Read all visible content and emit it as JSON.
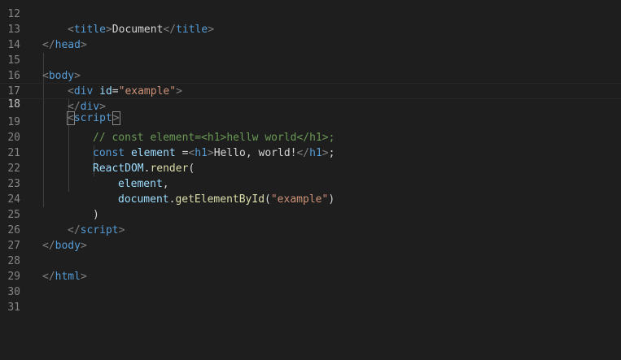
{
  "editor": {
    "line_numbers": [
      "12",
      "13",
      "14",
      "15",
      "16",
      "17",
      "18",
      "19",
      "20",
      "21",
      "22",
      "23",
      "24",
      "25",
      "26",
      "27",
      "28",
      "29",
      "30",
      "31"
    ],
    "active_line": "18",
    "lines": {
      "l12": {
        "open": "<",
        "tag": "title",
        "close": ">",
        "text": "Document",
        "end_open": "</",
        "end_tag": "title",
        "end_close": ">"
      },
      "l13": {
        "open": "</",
        "tag": "head",
        "close": ">"
      },
      "l15": {
        "open": "<",
        "tag": "body",
        "close": ">"
      },
      "l16": {
        "open": "<",
        "tag": "div",
        "attr": "id",
        "eq": "=",
        "val": "\"example\"",
        "close": ">"
      },
      "l17": {
        "open": "</",
        "tag": "div",
        "close": ">"
      },
      "l18": {
        "open": "<",
        "tag": "script",
        "close": ">"
      },
      "l19": {
        "comment": "// const element=<h1>hellw world</h1>;"
      },
      "l20": {
        "kw": "const",
        "var": "element",
        "op": " =",
        "open": "<",
        "tag": "h1",
        "close": ">",
        "text": "Hello, world!",
        "end_open": "</",
        "end_tag": "h1",
        "end_close": ">",
        "semi": ";"
      },
      "l21": {
        "obj": "ReactDOM",
        "dot": ".",
        "fn": "render",
        "paren": "("
      },
      "l22": {
        "var": "element",
        "comma": ","
      },
      "l23": {
        "obj": "document",
        "dot": ".",
        "fn": "getElementById",
        "paren_open": "(",
        "str": "\"example\"",
        "paren_close": ")"
      },
      "l24": {
        "paren": ")"
      },
      "l25": {
        "open": "</",
        "tag": "script",
        "close": ">"
      },
      "l26": {
        "open": "</",
        "tag": "body",
        "close": ">"
      },
      "l28": {
        "open": "</",
        "tag": "html",
        "close": ">"
      }
    }
  }
}
